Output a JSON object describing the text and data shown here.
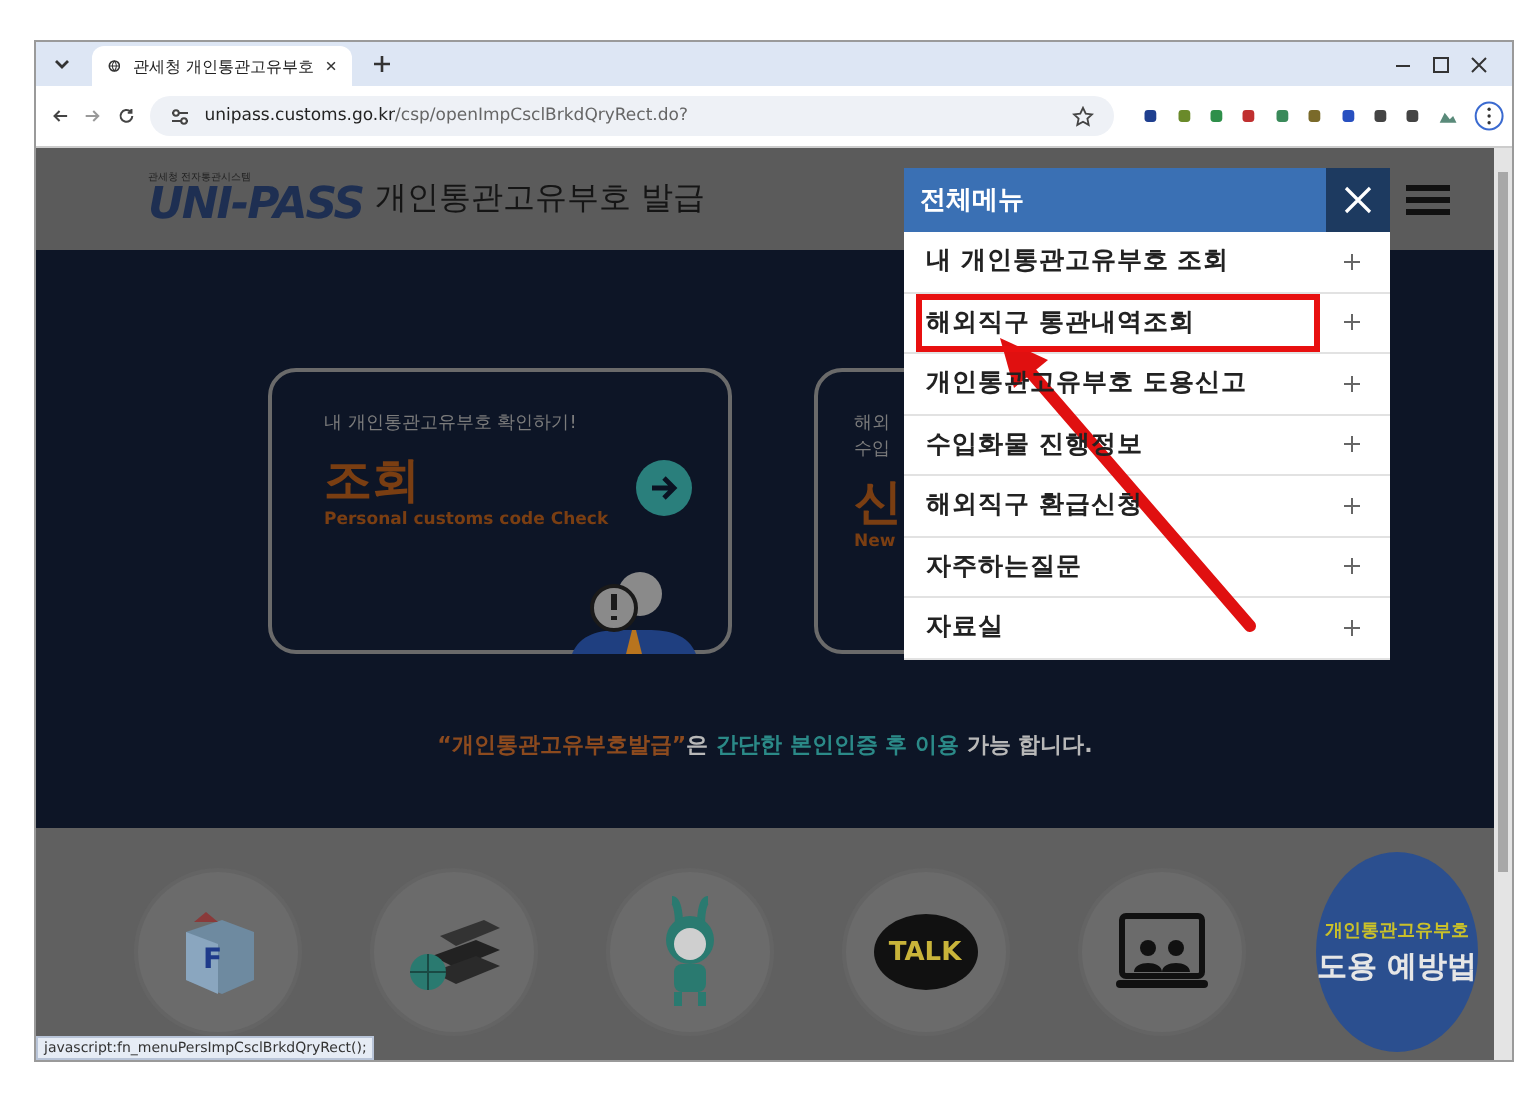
{
  "browser": {
    "tab_title": "관세청 개인통관고유부호",
    "url_host": "unipass.customs.go.kr",
    "url_path": "/csp/openImpCsclBrkdQryRect.do?",
    "status_url": "javascript:fn_menuPersImpCsclBrkdQryRect();"
  },
  "header": {
    "logo_caption": "관세청 전자통관시스템",
    "logo": "UNI-PASS",
    "title": "개인통관고유부호 발급"
  },
  "cards": [
    {
      "subtitle_lines": [
        "내 개인통관고유부호 확인하기!"
      ],
      "title": "조회",
      "english": "Personal customs code Check",
      "kind": "lookup"
    },
    {
      "subtitle_lines": [
        "해외",
        "수입"
      ],
      "title": "신",
      "english": "New",
      "kind": "partial"
    }
  ],
  "notice": [
    {
      "text": "“개인통관고유부호발급”",
      "kind": "orange"
    },
    {
      "text": "은 ",
      "kind": "plain"
    },
    {
      "text": "간단한 본인인증 후 이용",
      "kind": "teal"
    },
    {
      "text": " 가능 합니다.",
      "kind": "plain"
    }
  ],
  "quick_links": [
    {
      "kind": "cube",
      "text": "F"
    },
    {
      "kind": "books"
    },
    {
      "kind": "mascot"
    },
    {
      "kind": "talk",
      "text": "TALK"
    },
    {
      "kind": "video"
    },
    {
      "kind": "banner",
      "lines": [
        "개인통관고유부호",
        "도용 예방법"
      ]
    }
  ],
  "menu": {
    "title": "전체메뉴",
    "items": [
      {
        "label": "내 개인통관고유부호 조회",
        "annotated": false
      },
      {
        "label": "해외직구 통관내역조회",
        "annotated": true
      },
      {
        "label": "개인통관고유부호 도용신고",
        "annotated": false
      },
      {
        "label": "수입화물 진행정보",
        "annotated": false
      },
      {
        "label": "해외직구 환급신청",
        "annotated": false
      },
      {
        "label": "자주하는질문",
        "annotated": false
      },
      {
        "label": "자료실",
        "annotated": false
      }
    ]
  }
}
